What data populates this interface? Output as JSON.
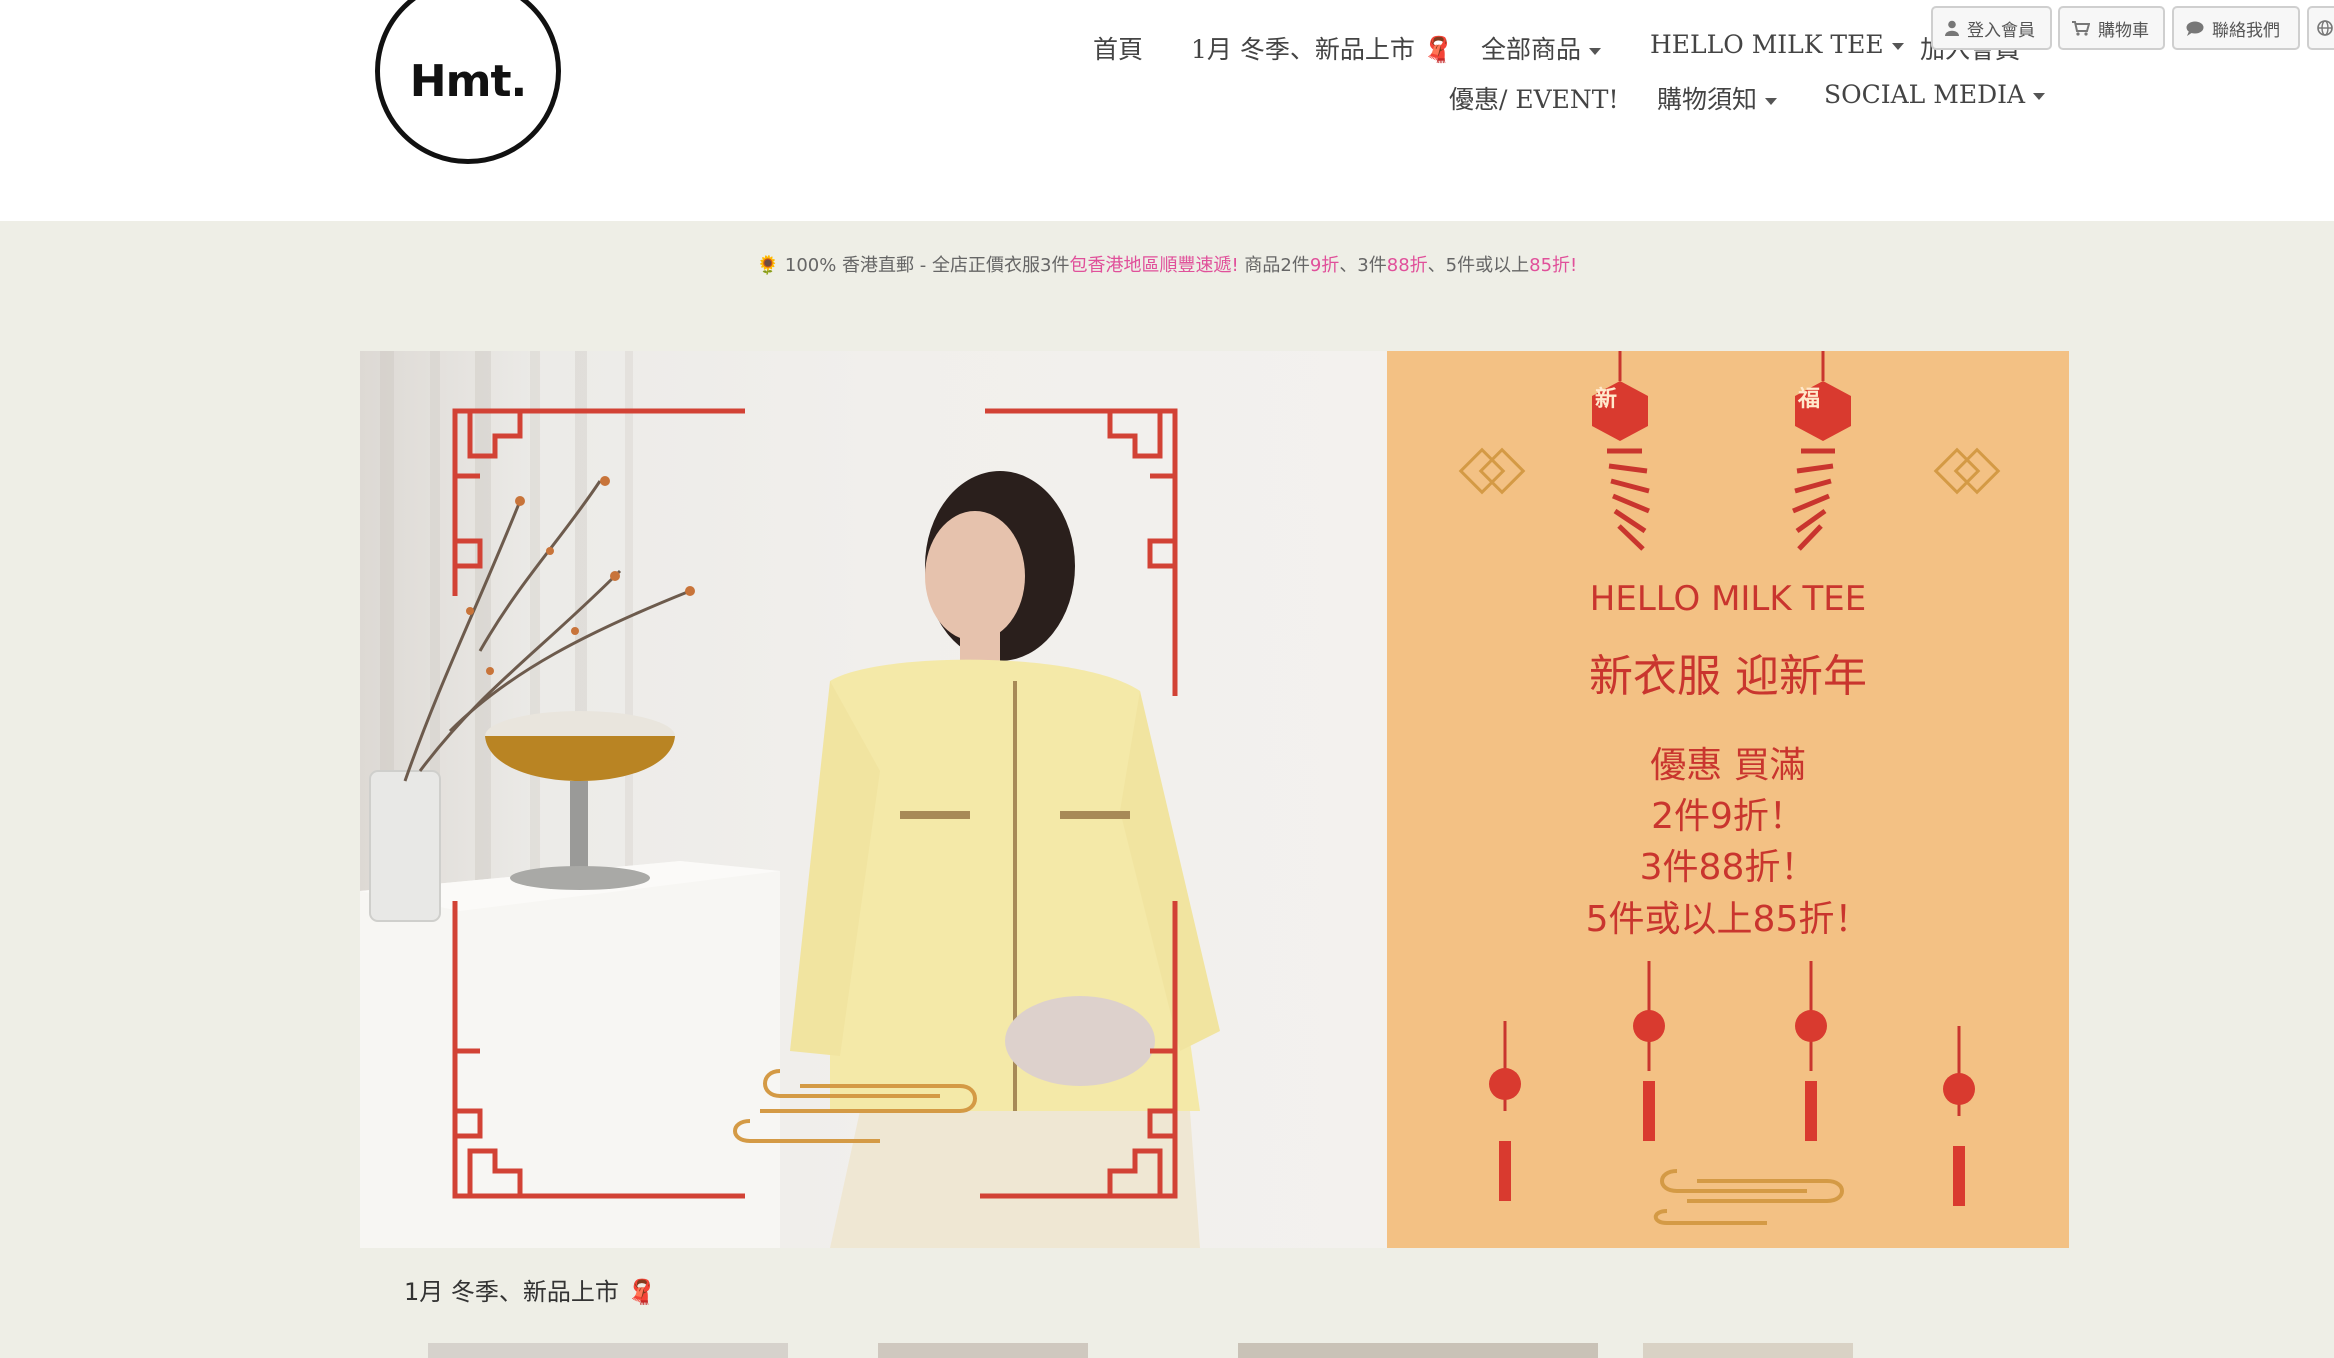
{
  "brand": {
    "logo_text": "Hmt."
  },
  "nav": {
    "row1": [
      {
        "label": "首頁",
        "caret": false
      },
      {
        "label": "1月 冬季、新品上市 🧣",
        "caret": false
      },
      {
        "label": "全部商品",
        "caret": true
      },
      {
        "label": "HELLO MILK TEE",
        "caret": true
      },
      {
        "label": "加入會員",
        "caret": false
      }
    ],
    "row2": [
      {
        "label": "優惠/ EVENT!",
        "caret": false
      },
      {
        "label": "購物須知",
        "caret": true
      },
      {
        "label": "SOCIAL MEDIA",
        "caret": true
      }
    ]
  },
  "top_buttons": {
    "login": "登入會員",
    "cart": "購物車",
    "contact": "聯絡我們"
  },
  "announcement": {
    "icon": "🌻",
    "part1": " 100% 香港直郵 - 全店正價衣服3件",
    "part2": "包香港地區順豐速遞!",
    "part3": "  商品2件",
    "part4": "9折",
    "part5": "、3件",
    "part6": "88折",
    "part7": "、5件或以上",
    "part8": "85折!"
  },
  "banner": {
    "brand_line": "HELLO MILK TEE",
    "headline": "新衣服 迎新年",
    "offer_lines": [
      "優惠 買滿",
      "2件9折！",
      "3件88折！",
      "5件或以上85折！"
    ],
    "lantern_left": "新",
    "lantern_right": "福"
  },
  "section": {
    "title": "1月 冬季、新品上市 🧣"
  },
  "colors": {
    "accent_pink": "#e0509a",
    "banner_panel": "#f3c184",
    "banner_red": "#c9352e",
    "page_bg": "#eeeee6"
  }
}
